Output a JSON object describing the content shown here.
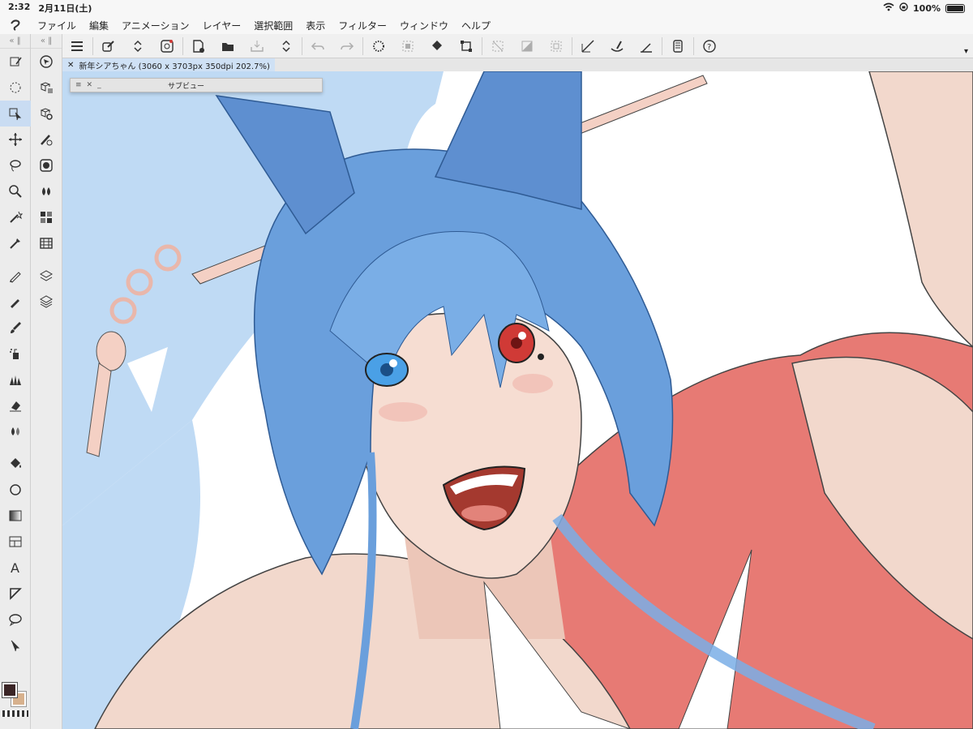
{
  "status": {
    "time": "2:32",
    "date": "2月11日(土)",
    "battery": "100%"
  },
  "menu": [
    "ファイル",
    "編集",
    "アニメーション",
    "レイヤー",
    "選択範囲",
    "表示",
    "フィルター",
    "ウィンドウ",
    "ヘルプ"
  ],
  "document": {
    "tab_title": "新年シアちゃん (3060 x 3703px 350dpi 202.7%)"
  },
  "subview": {
    "title": "サブビュー"
  },
  "colors": {
    "main": "#3b2526",
    "sub": "#d7b18d",
    "accent": "#c9dcf2"
  },
  "artwork": {
    "sky": "#bfdaf4",
    "hair": "#6a9fdc",
    "skin": "#f2d8cc",
    "kimono": "#e77a74",
    "eye_left": "#4aa0e6",
    "eye_right": "#d03a36"
  }
}
